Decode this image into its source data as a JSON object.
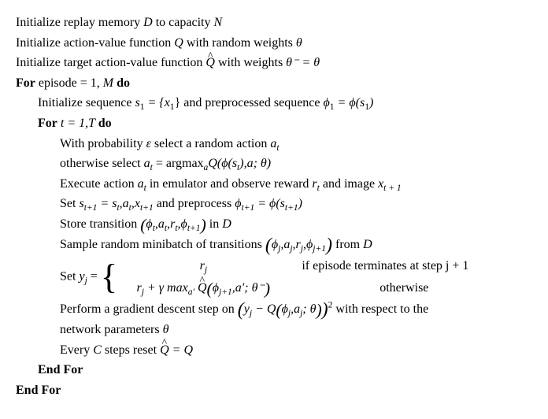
{
  "l1_a": "Initialize replay memory ",
  "l1_D": "D",
  "l1_b": " to capacity ",
  "l1_N": "N",
  "l2_a": "Initialize action-value function ",
  "l2_Q": "Q",
  "l2_b": " with random weights ",
  "l2_theta": "θ",
  "l3_a": "Initialize target action-value function ",
  "l3_Q": "Q",
  "l3_b": " with weights ",
  "l3_eq": "θ⁻ = θ",
  "l4_for": "For",
  "l4_a": " episode = 1, ",
  "l4_M": "M ",
  "l4_do": "do",
  "l5_a": "Initialize sequence ",
  "l5_s1": "s",
  "l5_sub1": "1",
  "l5_eq": " = {x",
  "l5_sub2": "1",
  "l5_b": "} and preprocessed sequence ",
  "l5_phi": "ϕ",
  "l5_sub3": "1",
  "l5_eq2": " = ϕ(s",
  "l5_sub4": "1",
  "l5_close": ")",
  "l6_for": "For",
  "l6_a": " t = 1,T ",
  "l6_do": "do",
  "l7_a": "With probability ",
  "l7_eps": "ε",
  "l7_b": " select a random action ",
  "l7_at": "a",
  "l7_t": "t",
  "l8_a": "otherwise select ",
  "l8_at": "a",
  "l8_t": "t",
  "l8_eq": " = argmax",
  "l8_suba": "a",
  "l8_Q": "Q",
  "l8_b": "(ϕ(s",
  "l8_subt": "t",
  "l8_c": "),a; θ",
  "l8_close": ")",
  "l9_a": "Execute action ",
  "l9_at": "a",
  "l9_t": "t",
  "l9_b": " in emulator and observe reward ",
  "l9_r": "r",
  "l9_t2": "t",
  "l9_c": " and image ",
  "l9_x": "x",
  "l9_t3": "t + 1",
  "l10_a": "Set ",
  "l10_s": "s",
  "l10_t1": "t+1",
  "l10_eq": " = s",
  "l10_t2": "t",
  "l10_c": ",a",
  "l10_t3": "t",
  "l10_c2": ",x",
  "l10_t4": "t+1",
  "l10_b": " and preprocess ",
  "l10_phi": "ϕ",
  "l10_t5": "t+1",
  "l10_eq2": " = ϕ(s",
  "l10_t6": "t+1",
  "l10_close": ")",
  "l11_a": "Store transition ",
  "l11_lp": "(",
  "l11_phi": "ϕ",
  "l11_t": "t",
  "l11_c": ",a",
  "l11_t2": "t",
  "l11_c2": ",r",
  "l11_t3": "t",
  "l11_c3": ",ϕ",
  "l11_t4": "t+1",
  "l11_rp": ")",
  "l11_b": " in ",
  "l11_D": "D",
  "l12_a": "Sample random minibatch of transitions ",
  "l12_lp": "(",
  "l12_phi": "ϕ",
  "l12_j": "j",
  "l12_c": ",a",
  "l12_j2": "j",
  "l12_c2": ",r",
  "l12_j3": "j",
  "l12_c3": ",ϕ",
  "l12_j4": "j+1",
  "l12_rp": ")",
  "l12_b": " from ",
  "l12_D": "D",
  "l13_a": "Set ",
  "l13_y": "y",
  "l13_j": "j",
  "l13_eq": " = ",
  "l13_case1_r": "r",
  "l13_case1_j": "j",
  "l13_cond1": "if episode terminates at step j + 1",
  "l13_case2_r": "r",
  "l13_case2_j": "j",
  "l13_case2_plus": " + γ max",
  "l13_case2_suba": "a′",
  "l13_case2_sp": " ",
  "l13_case2_Q": "Q",
  "l13_case2_lp": "(",
  "l13_case2_phi": "ϕ",
  "l13_case2_j1": "j+1",
  "l13_case2_c": ",a′; θ⁻",
  "l13_case2_rp": ")",
  "l13_cond2": "otherwise",
  "l14_a": "Perform a gradient descent step on ",
  "l14_lp": "(",
  "l14_y": "y",
  "l14_j": "j",
  "l14_minus": " − Q",
  "l14_lp2": "(",
  "l14_phi": "ϕ",
  "l14_j2": "j",
  "l14_c": ",a",
  "l14_j3": "j",
  "l14_c2": "; θ",
  "l14_rp2": ")",
  "l14_rp": ")",
  "l14_sq": "2",
  "l14_b": " with respect to the",
  "l14_c3": "network parameters ",
  "l14_theta": "θ",
  "l15_a": "Every ",
  "l15_C": "C",
  "l15_b": " steps reset ",
  "l15_Q": "Q",
  "l15_eq": " = Q",
  "l16": "End For",
  "l17": "End For"
}
